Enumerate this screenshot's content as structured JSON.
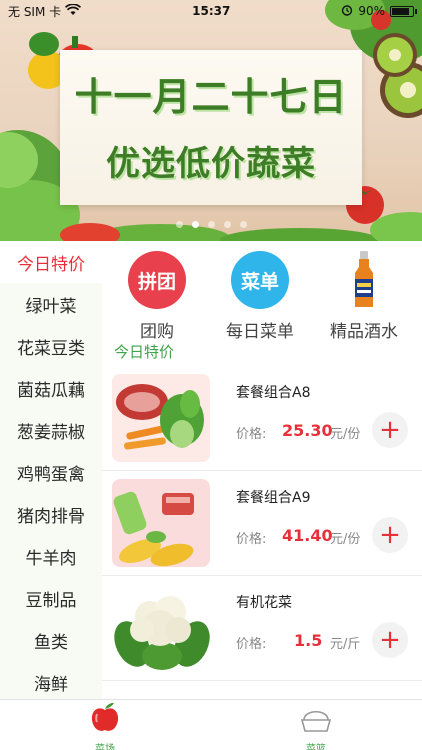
{
  "status_bar": {
    "carrier": "无 SIM 卡",
    "time": "15:37",
    "battery": "90%",
    "battery_level": 0.9,
    "icons": [
      "wifi-icon",
      "alarm-icon",
      "battery-icon"
    ]
  },
  "banner": {
    "line1": "十一月二十七日",
    "line2": "优选低价蔬菜",
    "page_count": 5,
    "active_page": 1
  },
  "sidebar": {
    "items": [
      {
        "label": "今日特价",
        "active": true
      },
      {
        "label": "绿叶菜"
      },
      {
        "label": "花菜豆类"
      },
      {
        "label": "菌菇瓜藕"
      },
      {
        "label": "葱姜蒜椒"
      },
      {
        "label": "鸡鸭蛋禽"
      },
      {
        "label": "猪肉排骨"
      },
      {
        "label": "牛羊肉"
      },
      {
        "label": "豆制品"
      },
      {
        "label": "鱼类"
      },
      {
        "label": "海鲜"
      }
    ]
  },
  "quick_links": [
    {
      "badge": "拼团",
      "label": "团购",
      "color": "#e8414d"
    },
    {
      "badge": "菜单",
      "label": "每日菜单",
      "color": "#2fb5ea"
    },
    {
      "badge": "",
      "label": "精品酒水",
      "icon": "beer-bottle-icon"
    }
  ],
  "section": {
    "title": "今日特价"
  },
  "products": [
    {
      "name": "套餐组合A8",
      "price_label": "价格:",
      "price": "25.30",
      "unit": "元/份"
    },
    {
      "name": "套餐组合A9",
      "price_label": "价格:",
      "price": "41.40",
      "unit": "元/份"
    },
    {
      "name": "有机花菜",
      "price_label": "价格:",
      "price": "1.5",
      "unit": "元/斤"
    }
  ],
  "tabbar": {
    "items": [
      {
        "label": "菜场",
        "icon": "apple-icon",
        "active": true
      },
      {
        "label": "菜篮",
        "icon": "basket-icon",
        "active": false
      }
    ]
  },
  "colors": {
    "accent_red": "#e8303a",
    "accent_green": "#3ea34a",
    "sidebar_bg": "#f7fbf4"
  }
}
